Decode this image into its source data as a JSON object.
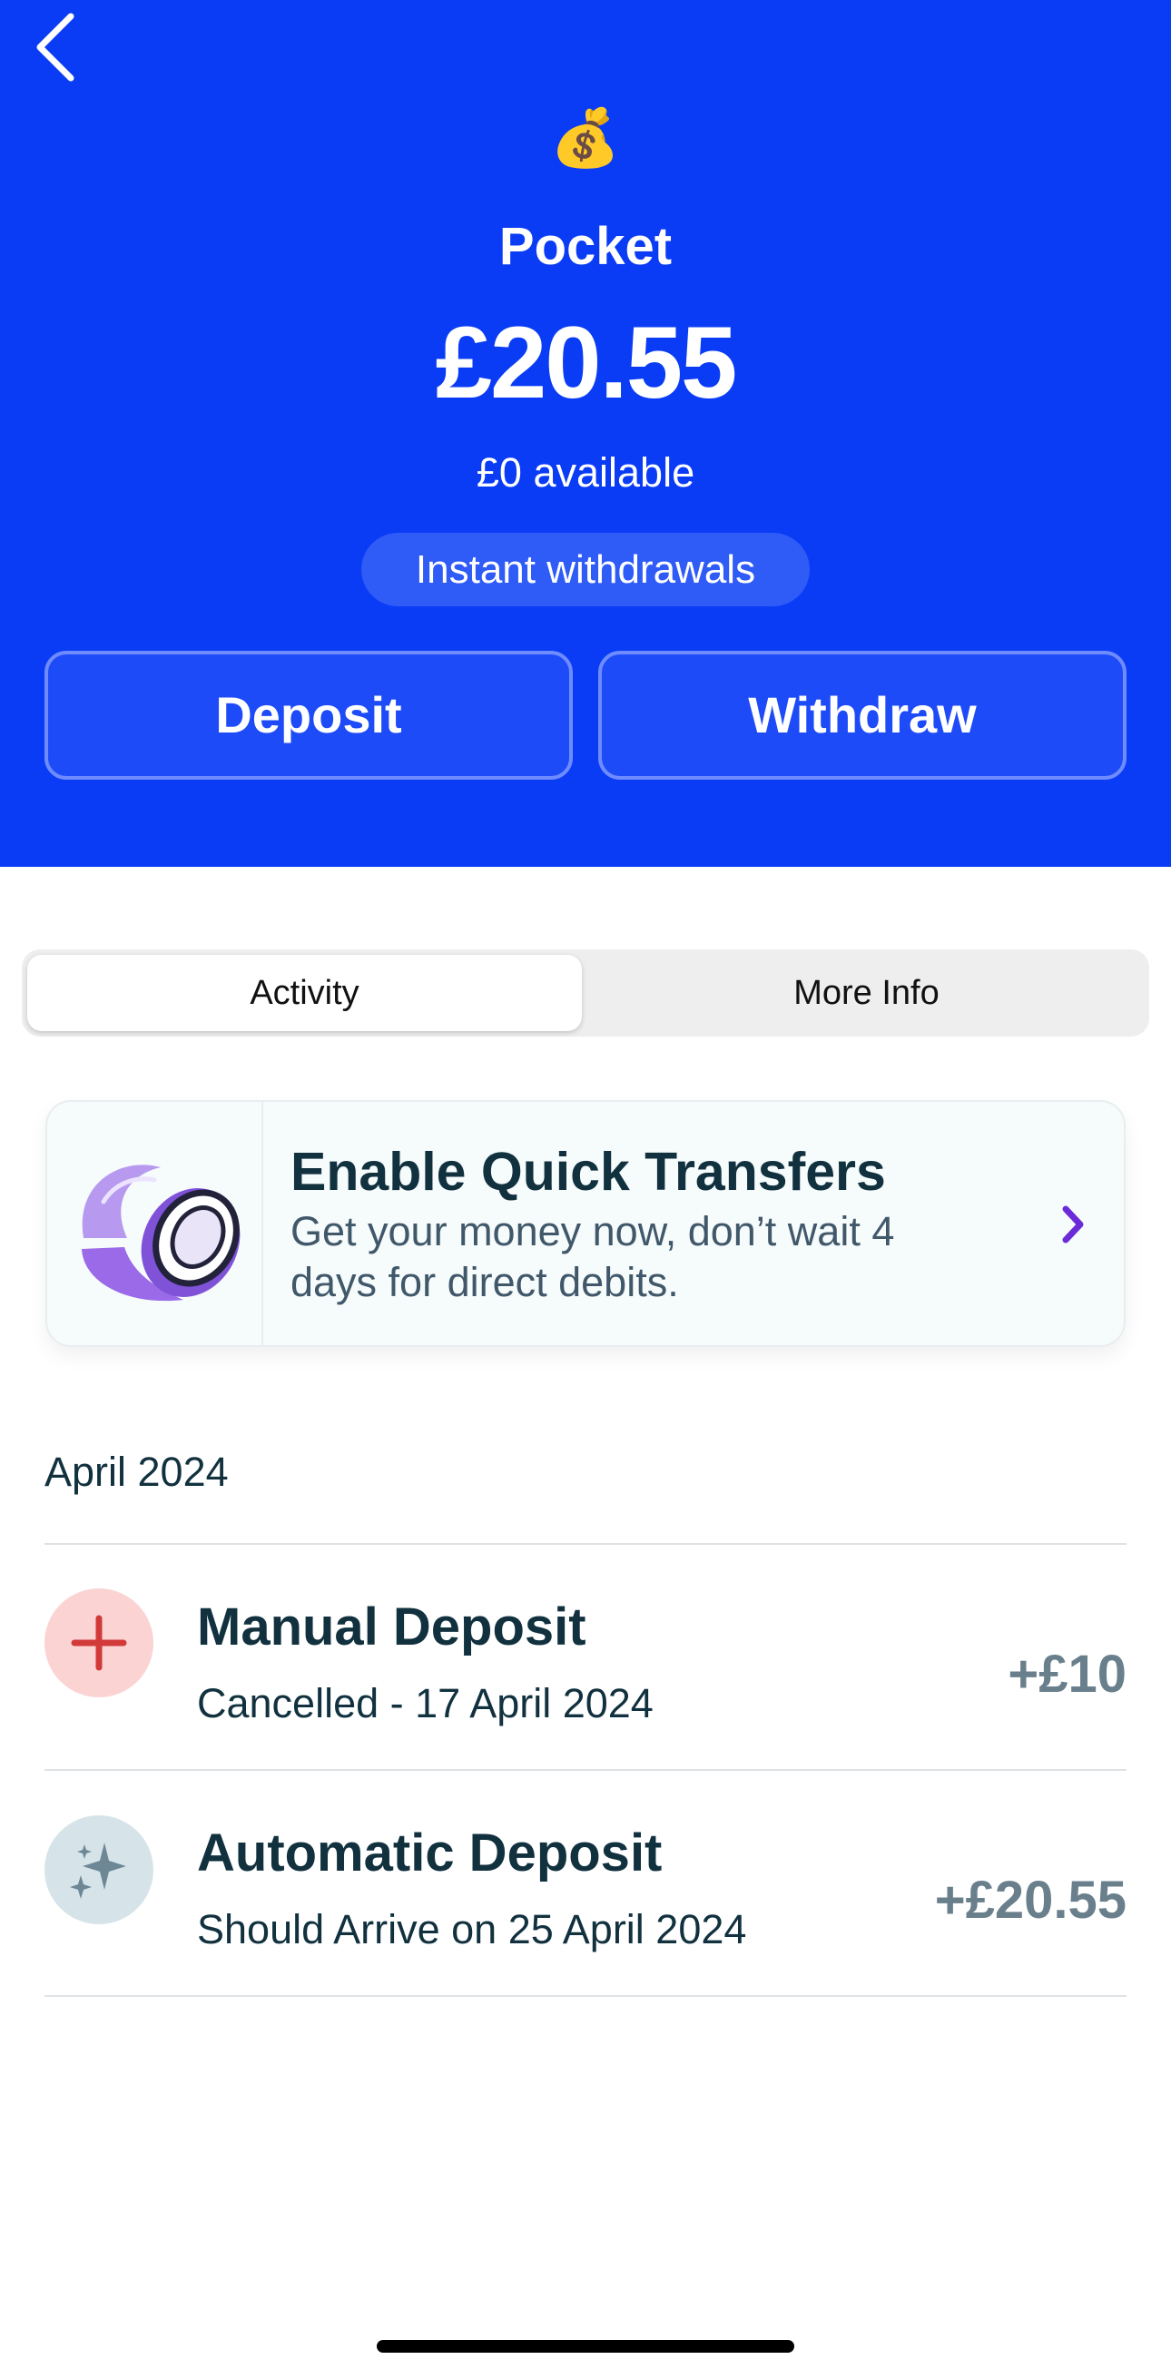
{
  "header": {
    "back_icon": "chevron-left-icon",
    "emoji": "💰",
    "title": "Pocket",
    "balance": "£20.55",
    "available": "£0 available",
    "badge": "Instant withdrawals",
    "deposit_label": "Deposit",
    "withdraw_label": "Withdraw"
  },
  "tabs": [
    {
      "label": "Activity",
      "selected": true
    },
    {
      "label": "More Info",
      "selected": false
    }
  ],
  "promo": {
    "icon": "coin-icon",
    "title": "Enable Quick Transfers",
    "body": "Get your money now, don’t wait 4 days for direct debits.",
    "chevron_icon": "chevron-right-icon"
  },
  "activity": {
    "month": "April 2024",
    "transactions": [
      {
        "title": "Manual Deposit",
        "subtitle": "Cancelled - 17 April 2024",
        "amount": "+£10",
        "icon": "plus-icon"
      },
      {
        "title": "Automatic Deposit",
        "subtitle": "Should Arrive on 25 April 2024",
        "amount": "+£20.55",
        "icon": "sparkle-icon"
      }
    ]
  },
  "colors": {
    "brand_blue": "#0a3cf5",
    "accent_purple": "#6b2bd9",
    "manual_icon_bg": "#fbd3d3",
    "manual_icon_fg": "#d23a3a",
    "auto_icon_bg": "#d6e4ea",
    "auto_icon_fg": "#6d8795",
    "amount_grey": "#6a7f8c"
  }
}
